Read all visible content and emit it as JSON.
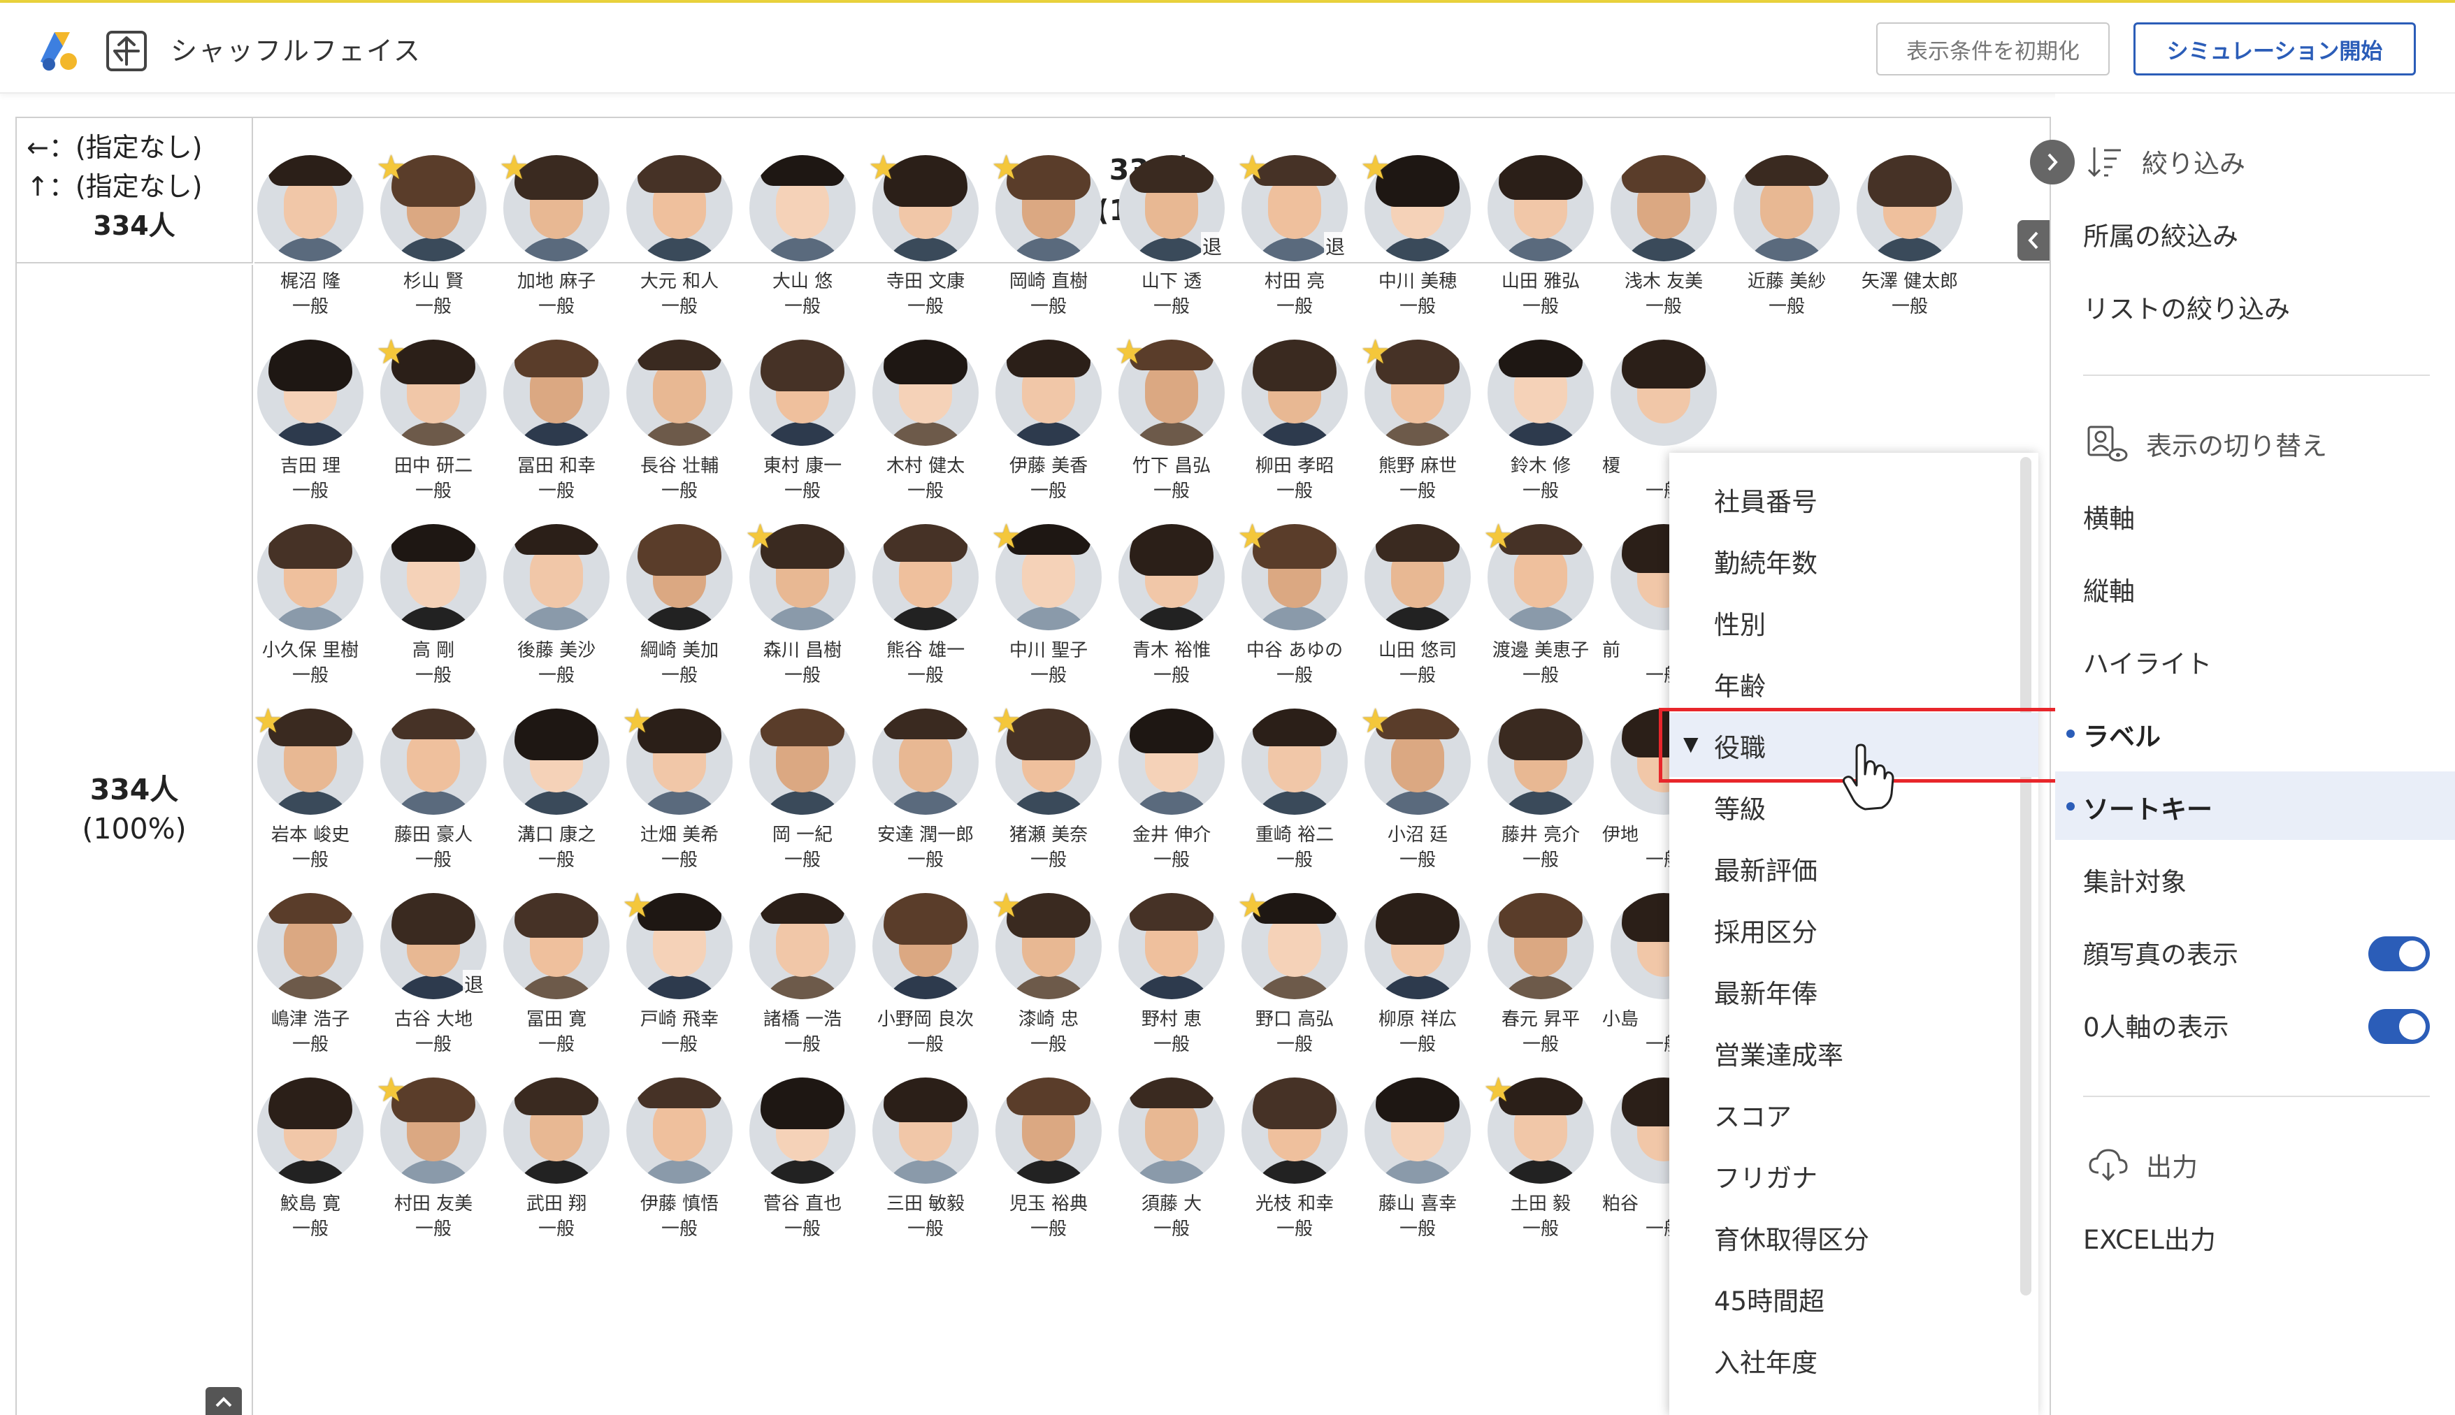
{
  "app": {
    "title": "シャッフルフェイス"
  },
  "header": {
    "reset_label": "表示条件を初期化",
    "simulate_label": "シミュレーション開始"
  },
  "grid": {
    "corner": {
      "x_axis": "←：(指定なし)",
      "y_axis": "↑：(指定なし)",
      "total": "334人"
    },
    "column_header": {
      "count": "334人",
      "percent": "(100%)"
    },
    "row_header": {
      "count": "334人",
      "percent": "(100%)"
    }
  },
  "people": [
    [
      {
        "name": "梶沼 隆",
        "role": "一般",
        "star": false,
        "retired": false
      },
      {
        "name": "杉山 賢",
        "role": "一般",
        "star": true,
        "retired": false
      },
      {
        "name": "加地 麻子",
        "role": "一般",
        "star": true,
        "retired": false
      },
      {
        "name": "大元 和人",
        "role": "一般",
        "star": false,
        "retired": false
      },
      {
        "name": "大山 悠",
        "role": "一般",
        "star": false,
        "retired": false
      },
      {
        "name": "寺田 文康",
        "role": "一般",
        "star": true,
        "retired": false
      },
      {
        "name": "岡崎 直樹",
        "role": "一般",
        "star": true,
        "retired": false
      },
      {
        "name": "山下 透",
        "role": "一般",
        "star": false,
        "retired": true
      },
      {
        "name": "村田 亮",
        "role": "一般",
        "star": true,
        "retired": true
      },
      {
        "name": "中川 美穂",
        "role": "一般",
        "star": true,
        "retired": false
      },
      {
        "name": "山田 雅弘",
        "role": "一般",
        "star": false,
        "retired": false
      },
      {
        "name": "浅木 友美",
        "role": "一般",
        "star": false,
        "retired": false
      },
      {
        "name": "近藤 美紗",
        "role": "一般",
        "star": false,
        "retired": false
      },
      {
        "name": "矢澤 健太郎",
        "role": "一般",
        "star": false,
        "retired": false
      }
    ],
    [
      {
        "name": "吉田 理",
        "role": "一般",
        "star": false,
        "retired": false
      },
      {
        "name": "田中 研二",
        "role": "一般",
        "star": true,
        "retired": false
      },
      {
        "name": "冨田 和幸",
        "role": "一般",
        "star": false,
        "retired": false
      },
      {
        "name": "長谷 壮輔",
        "role": "一般",
        "star": false,
        "retired": false
      },
      {
        "name": "東村 康一",
        "role": "一般",
        "star": false,
        "retired": false
      },
      {
        "name": "木村 健太",
        "role": "一般",
        "star": false,
        "retired": false
      },
      {
        "name": "伊藤 美香",
        "role": "一般",
        "star": false,
        "retired": false
      },
      {
        "name": "竹下 昌弘",
        "role": "一般",
        "star": true,
        "retired": false
      },
      {
        "name": "柳田 孝昭",
        "role": "一般",
        "star": false,
        "retired": false
      },
      {
        "name": "熊野 麻世",
        "role": "一般",
        "star": true,
        "retired": false
      },
      {
        "name": "鈴木 修",
        "role": "一般",
        "star": false,
        "retired": false
      }
    ],
    [
      {
        "name": "小久保 里樹",
        "role": "一般",
        "star": false,
        "retired": false
      },
      {
        "name": "高 剛",
        "role": "一般",
        "star": false,
        "retired": false
      },
      {
        "name": "後藤 美沙",
        "role": "一般",
        "star": false,
        "retired": false
      },
      {
        "name": "綱崎 美加",
        "role": "一般",
        "star": false,
        "retired": false
      },
      {
        "name": "森川 昌樹",
        "role": "一般",
        "star": true,
        "retired": false
      },
      {
        "name": "熊谷 雄一",
        "role": "一般",
        "star": false,
        "retired": false
      },
      {
        "name": "中川 聖子",
        "role": "一般",
        "star": true,
        "retired": false
      },
      {
        "name": "青木 裕惟",
        "role": "一般",
        "star": false,
        "retired": false
      },
      {
        "name": "中谷 あゆの",
        "role": "一般",
        "star": true,
        "retired": false
      },
      {
        "name": "山田 悠司",
        "role": "一般",
        "star": false,
        "retired": false
      },
      {
        "name": "渡邊 美恵子",
        "role": "一般",
        "star": true,
        "retired": false
      }
    ],
    [
      {
        "name": "岩本 峻史",
        "role": "一般",
        "star": true,
        "retired": false
      },
      {
        "name": "藤田 豪人",
        "role": "一般",
        "star": false,
        "retired": false
      },
      {
        "name": "溝口 康之",
        "role": "一般",
        "star": false,
        "retired": false
      },
      {
        "name": "辻畑 美希",
        "role": "一般",
        "star": true,
        "retired": false
      },
      {
        "name": "岡 一紀",
        "role": "一般",
        "star": false,
        "retired": false
      },
      {
        "name": "安達 潤一郎",
        "role": "一般",
        "star": false,
        "retired": false
      },
      {
        "name": "猪瀬 美奈",
        "role": "一般",
        "star": true,
        "retired": false
      },
      {
        "name": "金井 伸介",
        "role": "一般",
        "star": false,
        "retired": false
      },
      {
        "name": "重崎 裕二",
        "role": "一般",
        "star": false,
        "retired": false
      },
      {
        "name": "小沼 廷",
        "role": "一般",
        "star": true,
        "retired": false
      },
      {
        "name": "藤井 亮介",
        "role": "一般",
        "star": false,
        "retired": false
      }
    ],
    [
      {
        "name": "嶋津 浩子",
        "role": "一般",
        "star": false,
        "retired": false
      },
      {
        "name": "古谷 大地",
        "role": "一般",
        "star": false,
        "retired": true
      },
      {
        "name": "冨田 寛",
        "role": "一般",
        "star": false,
        "retired": false
      },
      {
        "name": "戸崎 飛幸",
        "role": "一般",
        "star": true,
        "retired": false
      },
      {
        "name": "諸橋 一浩",
        "role": "一般",
        "star": false,
        "retired": false
      },
      {
        "name": "小野岡 良次",
        "role": "一般",
        "star": false,
        "retired": false
      },
      {
        "name": "漆崎 忠",
        "role": "一般",
        "star": true,
        "retired": false
      },
      {
        "name": "野村 恵",
        "role": "一般",
        "star": false,
        "retired": false
      },
      {
        "name": "野口 高弘",
        "role": "一般",
        "star": true,
        "retired": false
      },
      {
        "name": "柳原 祥広",
        "role": "一般",
        "star": false,
        "retired": false
      },
      {
        "name": "春元 昇平",
        "role": "一般",
        "star": false,
        "retired": false
      }
    ],
    [
      {
        "name": "鮫島 寛",
        "role": "一般",
        "star": false,
        "retired": false
      },
      {
        "name": "村田 友美",
        "role": "一般",
        "star": true,
        "retired": false
      },
      {
        "name": "武田 翔",
        "role": "一般",
        "star": false,
        "retired": false
      },
      {
        "name": "伊藤 慎悟",
        "role": "一般",
        "star": false,
        "retired": false
      },
      {
        "name": "菅谷 直也",
        "role": "一般",
        "star": false,
        "retired": false
      },
      {
        "name": "三田 敏毅",
        "role": "一般",
        "star": false,
        "retired": false
      },
      {
        "name": "児玉 裕典",
        "role": "一般",
        "star": false,
        "retired": false
      },
      {
        "name": "須藤 大",
        "role": "一般",
        "star": false,
        "retired": false
      },
      {
        "name": "光枝 和幸",
        "role": "一般",
        "star": false,
        "retired": false
      },
      {
        "name": "藤山 喜幸",
        "role": "一般",
        "star": false,
        "retired": false
      },
      {
        "name": "土田 毅",
        "role": "一般",
        "star": true,
        "retired": false
      }
    ]
  ],
  "people_edge": [
    "榎",
    "前",
    "伊地",
    "小島",
    "粕谷"
  ],
  "retired_label": "退",
  "dropdown": {
    "items": [
      "社員番号",
      "勤続年数",
      "性別",
      "年齢",
      "役職",
      "等級",
      "最新評価",
      "採用区分",
      "最新年俸",
      "営業達成率",
      "スコア",
      "フリガナ",
      "育休取得区分",
      "45時間超",
      "入社年度"
    ],
    "selected": "役職"
  },
  "sidebar": {
    "filter": {
      "title": "絞り込み",
      "items": [
        "所属の絞込み",
        "リストの絞り込み"
      ]
    },
    "display": {
      "title": "表示の切り替え",
      "items": [
        "横軸",
        "縦軸",
        "ハイライト",
        "ラベル",
        "ソートキー",
        "集計対象"
      ]
    },
    "toggles": [
      {
        "label": "顔写真の表示",
        "on": true
      },
      {
        "label": "0人軸の表示",
        "on": true
      }
    ],
    "output": {
      "title": "出力",
      "items": [
        "EXCEL出力"
      ]
    }
  },
  "colors": {
    "accent": "#2b5db8",
    "highlight_border": "#e8262b",
    "star": "#f4c73b",
    "top_bar": "#e9d23c"
  }
}
